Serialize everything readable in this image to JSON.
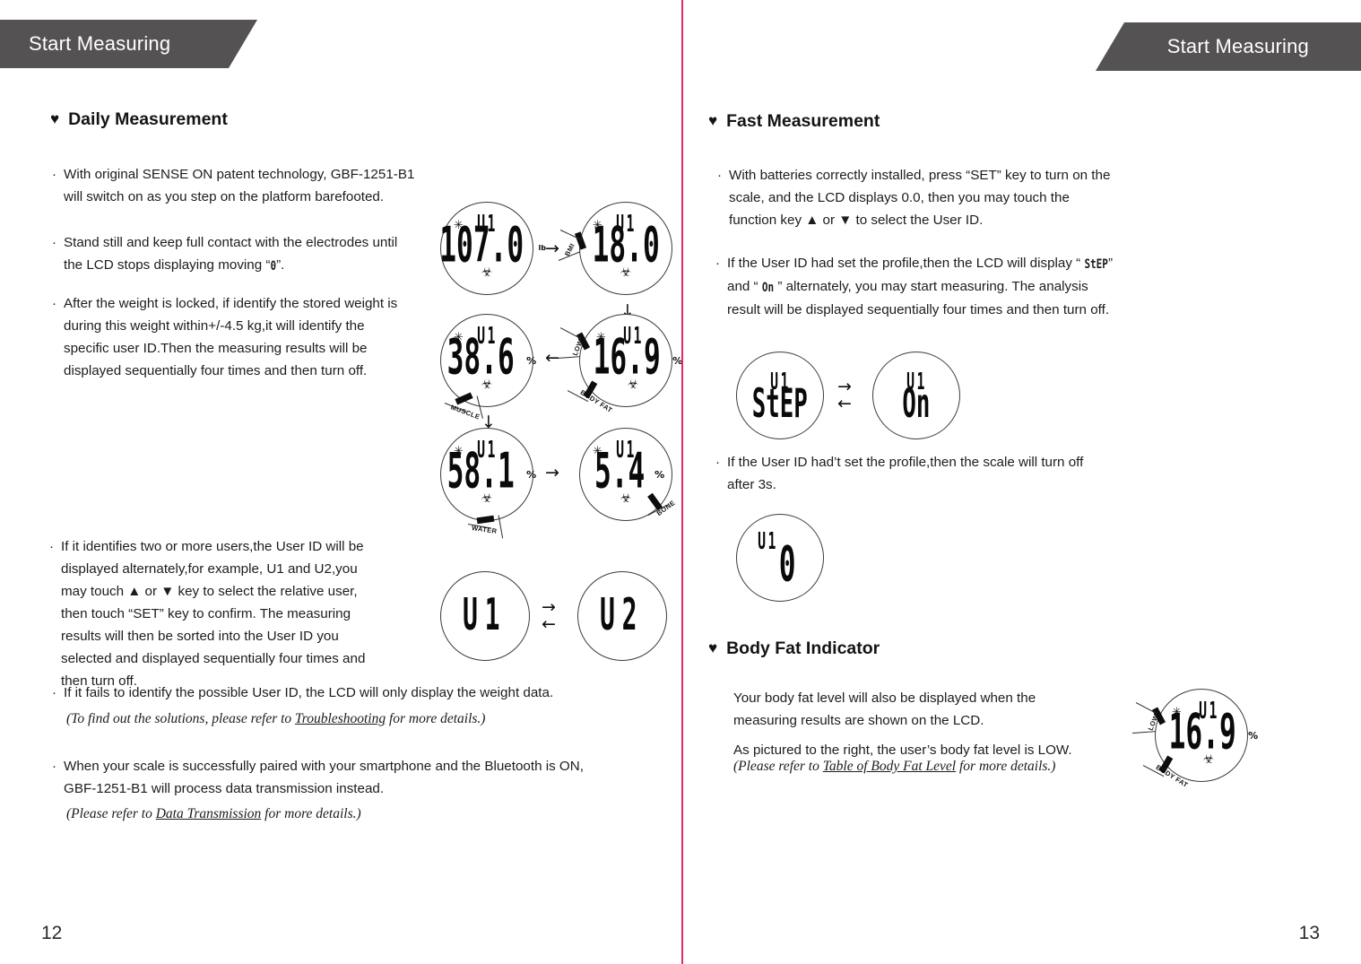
{
  "document": {
    "type": "product-manual-spread",
    "accent_color": "#e02a6e",
    "tab_color": "#545252"
  },
  "pages": {
    "left": {
      "tab_label": "Start Measuring",
      "page_number": "12",
      "section_title": "Daily Measurement",
      "bullets": [
        "With original SENSE ON patent technology, GBF-1251-B1 will switch on as you step on the platform barefooted.",
        "Stand still and keep full contact with the electrodes until the LCD stops displaying moving “0”.",
        "After the weight is locked, if identify the stored weight is during this weight within+/-4.5 kg,it will identify the specific user ID.Then the measuring results will be displayed sequentially four times and then turn off.",
        "If it identifies two or more users,the User ID will be displayed alternately,for example, U1 and U2,you may touch ▲ or ▼ key to select the relative user, then touch “SET” key to confirm. The measuring results will then be sorted into the User ID you selected and displayed sequentially four times and then turn off.",
        "If it fails to identify the possible User ID, the LCD will only display the weight data.",
        "When your scale is successfully paired with your smartphone and the Bluetooth is ON, GBF-1251-B1 will process data transmission instead."
      ],
      "bullet_lines": {
        "b1": [
          "With original SENSE ON patent technology, GBF-1251-B1",
          "will switch on as you step on the platform barefooted."
        ],
        "b2_a": "Stand still and keep full contact with the electrodes until",
        "b2_b_pre": "the LCD stops displaying moving “",
        "b2_b_seg": "0",
        "b2_b_post": "”.",
        "b3": [
          "After the weight is locked, if identify the stored weight is",
          "during this weight within+/-4.5 kg,it will identify the",
          "specific user ID.Then the measuring results will be",
          "displayed sequentially four times and then turn off."
        ],
        "b4": [
          "If it identifies two or more users,the User ID will be",
          "displayed alternately,for example, U1 and U2,you",
          "may touch ▲ or ▼ key to select the relative user,",
          "then touch “SET” key to confirm. The measuring",
          "results will then be sorted into the User ID you",
          "selected and displayed sequentially four times and",
          "then turn off."
        ],
        "b5": [
          "If it fails to identify the possible User ID, the LCD will only display the weight data."
        ],
        "b6": [
          "When your scale is successfully paired with your smartphone and the Bluetooth is ON,",
          "GBF-1251-B1 will process data transmission instead."
        ]
      },
      "references": [
        {
          "pre": "(To find out the solutions, please refer to ",
          "link": "Troubleshooting",
          "post": " for more details.)"
        },
        {
          "pre": "(Please refer to ",
          "link": "Data Transmission",
          "post": " for more details.)"
        }
      ],
      "lcd_sequence": [
        {
          "id": "weight",
          "uid": "U1",
          "value": "107.0",
          "unit": "lb",
          "ring_label": "",
          "sun": true,
          "body": true
        },
        {
          "id": "bmi",
          "uid": "U1",
          "value": "18.0",
          "unit": "",
          "ring_label": "BMI",
          "sun": true,
          "body": true
        },
        {
          "id": "body-fat",
          "uid": "U1",
          "value": "16.9",
          "unit": "%",
          "ring_label": "BODY FAT",
          "ring_label2": "LOW",
          "sun": true,
          "body": true
        },
        {
          "id": "muscle",
          "uid": "U1",
          "value": "38.6",
          "unit": "%",
          "ring_label": "MUSCLE",
          "sun": true,
          "body": true
        },
        {
          "id": "water",
          "uid": "U1",
          "value": "58.1",
          "unit": "%",
          "ring_label": "WATER",
          "sun": true,
          "body": true
        },
        {
          "id": "bone",
          "uid": "U1",
          "value": "5.4",
          "unit": "%",
          "ring_label": "BONE",
          "sun": true,
          "body": true
        }
      ],
      "user_alternate": [
        {
          "id": "u1",
          "value": "U1"
        },
        {
          "id": "u2",
          "value": "U2"
        }
      ]
    },
    "right": {
      "tab_label": "Start Measuring",
      "page_number": "13",
      "sections": [
        {
          "id": "fast-measurement",
          "title": "Fast Measurement"
        },
        {
          "id": "body-fat-indicator",
          "title": "Body Fat Indicator"
        }
      ],
      "bullet_lines": {
        "b1": [
          "With batteries correctly installed, press “SET” key to turn on the",
          "scale, and the LCD displays 0.0, then you may touch the",
          "function key ▲ or ▼  to select the User ID."
        ],
        "b2_l1_pre": "If the User ID had set the profile,then the LCD will display “ ",
        "b2_l1_seg": "StEP",
        "b2_l1_post": "”",
        "b2_l2_pre": "and “ ",
        "b2_l2_seg": "On",
        "b2_l2_post": " ” alternately, you may start measuring. The analysis",
        "b2_l3": "result will be displayed sequentially four times and then turn off.",
        "b3": [
          "If the User ID had’t set the profile,then the scale will turn off",
          "after 3s."
        ]
      },
      "body_fat_text": [
        "Your body fat level will also be displayed when the",
        "measuring results are shown on the LCD.",
        "As pictured to the right, the user’s body fat level is LOW."
      ],
      "body_fat_reference": {
        "pre": "(Please refer to ",
        "link": "Table of Body Fat Level",
        "post": " for more details.)"
      },
      "lcd_alternate": [
        {
          "id": "step",
          "uid": "U1",
          "value": "StEP"
        },
        {
          "id": "on",
          "uid": "U1",
          "value": "On"
        }
      ],
      "lcd_zero": {
        "id": "zero",
        "uid": "U1",
        "value": "0"
      },
      "lcd_bodyfat": {
        "id": "body-fat-low",
        "uid": "U1",
        "value": "16.9",
        "unit": "%",
        "ring_label": "BODY FAT",
        "ring_label2": "LOW"
      }
    }
  },
  "icons": {
    "heart": "♥",
    "sun": "✳",
    "body": "☣",
    "arrow_right": "→",
    "arrow_left": "←",
    "arrow_down": "↓"
  }
}
